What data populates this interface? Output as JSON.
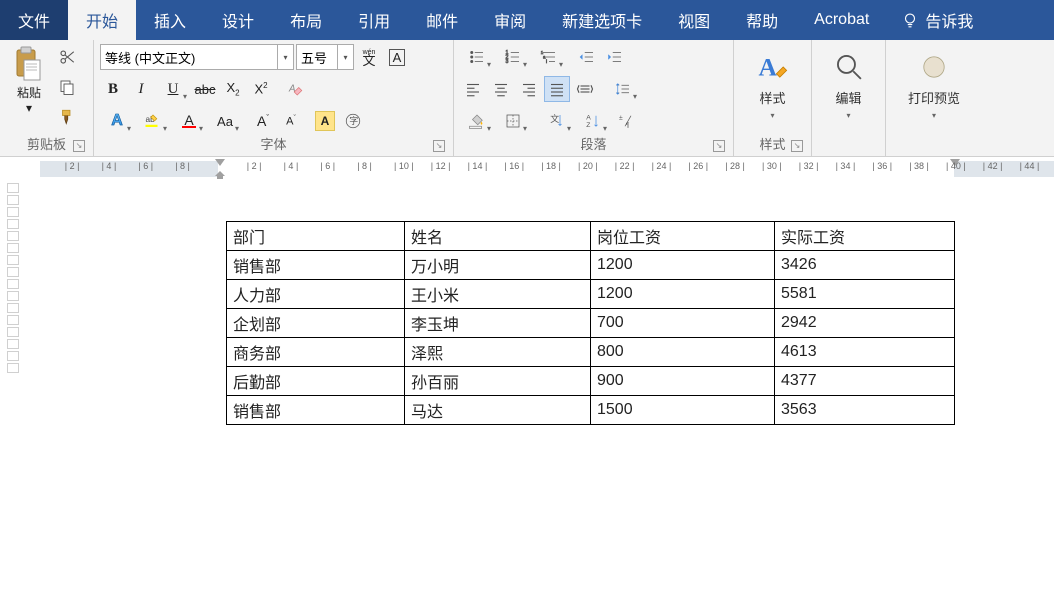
{
  "tabs": {
    "file": "文件",
    "home": "开始",
    "insert": "插入",
    "design": "设计",
    "layout": "布局",
    "references": "引用",
    "mail": "邮件",
    "review": "审阅",
    "newtab": "新建选项卡",
    "view": "视图",
    "help": "帮助",
    "acrobat": "Acrobat",
    "tellme": "告诉我"
  },
  "ribbon": {
    "clipboard": {
      "label": "剪贴板",
      "paste": "粘贴"
    },
    "font": {
      "label": "字体",
      "name": "等线 (中文正文)",
      "size": "五号",
      "pinyin": "wén",
      "A_box": "A"
    },
    "paragraph": {
      "label": "段落"
    },
    "styles": {
      "label": "样式",
      "button": "样式"
    },
    "editing": {
      "button": "编辑"
    },
    "preview": {
      "button": "打印预览"
    }
  },
  "ruler": {
    "labels_left": [
      "8",
      "6",
      "4",
      "2"
    ],
    "labels_right": [
      "2",
      "4",
      "6",
      "8",
      "10",
      "12",
      "14",
      "16",
      "18",
      "20",
      "22",
      "24",
      "26",
      "28",
      "30",
      "32",
      "34",
      "36",
      "38",
      "40",
      "42",
      "44"
    ]
  },
  "table": {
    "headers": [
      "部门",
      "姓名",
      "岗位工资",
      "实际工资"
    ],
    "rows": [
      [
        "销售部",
        "万小明",
        "1200",
        "3426"
      ],
      [
        "人力部",
        "王小米",
        "1200",
        "5581"
      ],
      [
        "企划部",
        "李玉坤",
        "700",
        "2942"
      ],
      [
        "商务部",
        "泽熙",
        "800",
        "4613"
      ],
      [
        "后勤部",
        "孙百丽",
        "900",
        "4377"
      ],
      [
        "销售部",
        "马达",
        "1500",
        "3563"
      ]
    ]
  }
}
